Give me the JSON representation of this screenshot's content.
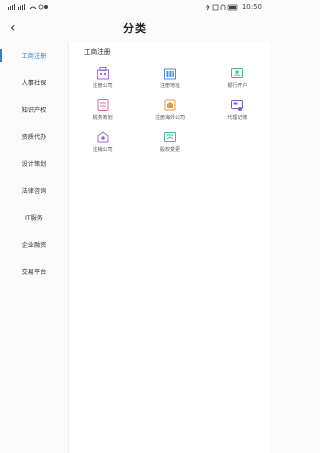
{
  "status_bar": {
    "time": "10:50",
    "battery": "94"
  },
  "header": {
    "title": "分类",
    "back": "‹"
  },
  "sidebar": {
    "items": [
      {
        "label": "工商注册",
        "active": true
      },
      {
        "label": "人事社保",
        "active": false
      },
      {
        "label": "知识产权",
        "active": false
      },
      {
        "label": "资质代办",
        "active": false
      },
      {
        "label": "设计策划",
        "active": false
      },
      {
        "label": "法律咨询",
        "active": false
      },
      {
        "label": "IT服务",
        "active": false
      },
      {
        "label": "企业融资",
        "active": false
      },
      {
        "label": "交易平台",
        "active": false
      }
    ]
  },
  "main": {
    "section_title": "工商注册",
    "services": [
      {
        "label": "注册公司",
        "icon": "building-icon",
        "color": "#9b6fd8"
      },
      {
        "label": "注册地址",
        "icon": "address-icon",
        "color": "#4a8fe0"
      },
      {
        "label": "银行开户",
        "icon": "bank-card-icon",
        "color": "#43b98c"
      },
      {
        "label": "税务筹划",
        "icon": "tax-plan-icon",
        "color": "#e0659a"
      },
      {
        "label": "注册海外公司",
        "icon": "overseas-icon",
        "color": "#ec9a3a"
      },
      {
        "label": "代理记账",
        "icon": "accounting-icon",
        "color": "#7a5ad6"
      },
      {
        "label": "注销公司",
        "icon": "cancel-company-icon",
        "color": "#9b6fd8"
      },
      {
        "label": "股权变更",
        "icon": "equity-change-icon",
        "color": "#43b98c"
      }
    ]
  }
}
